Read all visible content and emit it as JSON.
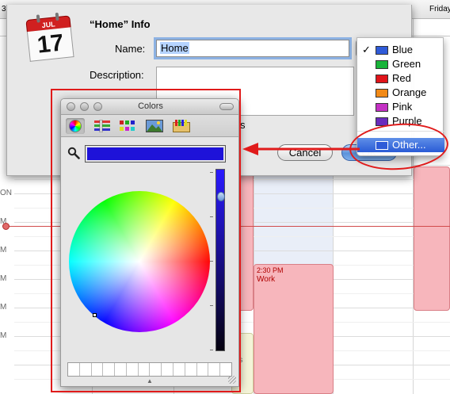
{
  "calendar": {
    "header_days": [
      "3",
      "Friday"
    ],
    "time_labels": [
      "ON",
      "M",
      "M",
      "M",
      "M",
      "M"
    ],
    "event_time": "2:30 PM",
    "event_title": "Work",
    "event2_partial": "kes"
  },
  "info_sheet": {
    "title": "“Home” Info",
    "icon_month": "JUL",
    "icon_day": "17",
    "name_label": "Name:",
    "name_value": "Home",
    "description_label": "Description:",
    "description_value": "",
    "stray_text": "s",
    "cancel_label": "Cancel",
    "ok_label": "OK"
  },
  "color_menu": {
    "items": [
      {
        "label": "Blue",
        "color": "#2f5bd8",
        "checked": "✓"
      },
      {
        "label": "Green",
        "color": "#19b43a",
        "checked": ""
      },
      {
        "label": "Red",
        "color": "#e0141a",
        "checked": ""
      },
      {
        "label": "Orange",
        "color": "#f28a17",
        "checked": ""
      },
      {
        "label": "Pink",
        "color": "#c431c4",
        "checked": ""
      },
      {
        "label": "Purple",
        "color": "#6a2bbd",
        "checked": ""
      }
    ],
    "other_label": "Other...",
    "other_color": "#2f5bd8"
  },
  "colors_panel": {
    "title": "Colors",
    "toolbar_icons": [
      "color-wheel-icon",
      "color-sliders-icon",
      "color-palettes-icon",
      "image-palettes-icon",
      "crayons-icon"
    ],
    "selected_color": "#1e12d9",
    "brightness": 0.85,
    "favorite_slots": 14
  },
  "annotation_color": "#e01b1b"
}
